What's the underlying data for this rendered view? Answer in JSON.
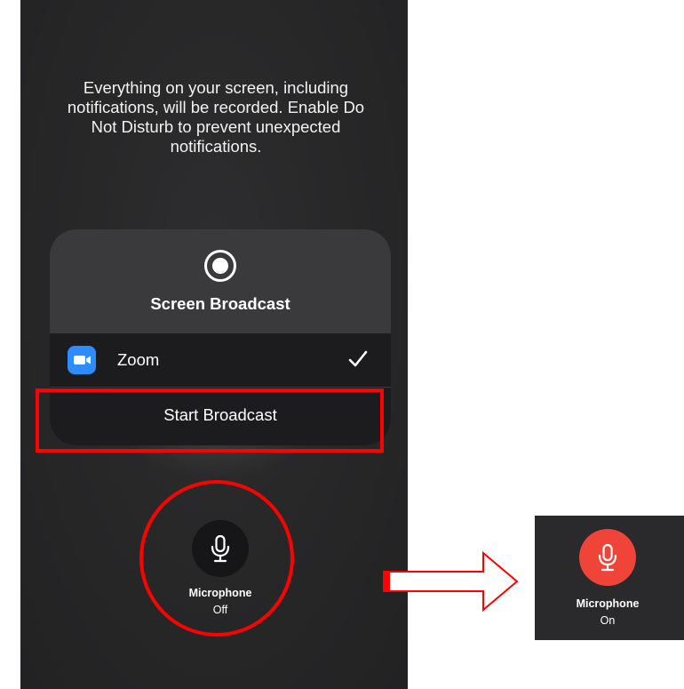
{
  "warning_text": "Everything on your screen, including notifications, will be recorded. Enable Do Not Disturb to prevent unexpected notifications.",
  "panel": {
    "title": "Screen Broadcast",
    "icon": "record-icon",
    "app": {
      "name": "Zoom",
      "icon": "zoom-camera-icon",
      "selected": true
    },
    "start_label": "Start Broadcast"
  },
  "microphone": {
    "label": "Microphone",
    "state": "Off",
    "icon": "microphone-icon"
  },
  "microphone_on": {
    "label": "Microphone",
    "state": "On",
    "icon": "microphone-icon",
    "color": "#f04438"
  },
  "colors": {
    "highlight": "#ff0000",
    "zoom_blue": "#2d8cff",
    "background": "#282829"
  }
}
